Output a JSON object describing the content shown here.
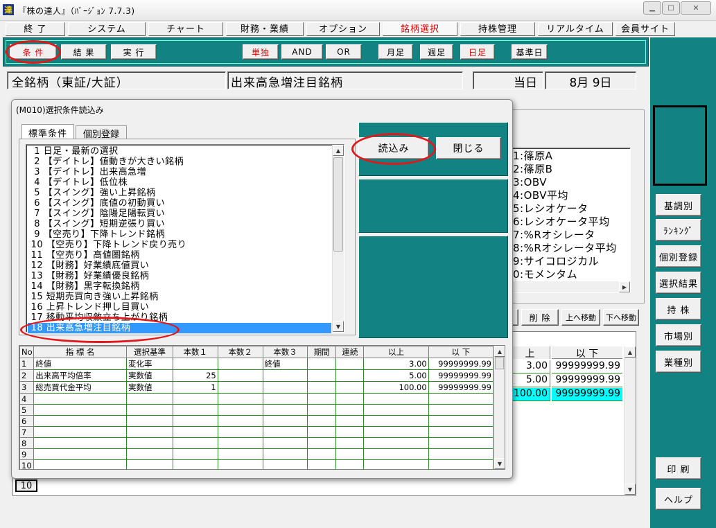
{
  "window": {
    "title": "『株の達人』（ﾊﾞｰｼﾞｮﾝ 7.7.3)",
    "logo": "達"
  },
  "menu": [
    "終 了",
    "システム",
    "チャート",
    "財務・業績",
    "オプション",
    "銘柄選択",
    "持株管理",
    "リアルタイム",
    "会員サイト"
  ],
  "toolbar": {
    "jouken": "条 件",
    "kekka": "結 果",
    "jikkou": "実 行",
    "tandoku": "単独",
    "and": "AND",
    "or": "OR",
    "getsu": "月足",
    "shuu": "週足",
    "hi": "日足",
    "kijunbi": "基準日"
  },
  "header": {
    "market": "全銘柄（東証/大証）",
    "screen": "出来高急増注目銘柄",
    "touka_label": "当日",
    "date": "8月 9日"
  },
  "right_buttons": [
    "基調別",
    "ﾗﾝｷﾝｸﾞ",
    "個別登録",
    "選択結果",
    "持 株",
    "市場別",
    "業種別"
  ],
  "bottom_buttons": [
    "印 刷",
    "ヘルプ"
  ],
  "bg_indicator_list": [
    "1:篠原A",
    "2:篠原B",
    "3:OBV",
    "4:OBV平均",
    "5:レシオケータ",
    "6:レシオケータ平均",
    "7:%Rオシレータ",
    "8:%Rオシレータ平均",
    "9:サイコロジカル",
    "0:モメンタム"
  ],
  "bg_actions": [
    "削 除",
    "上へ移動",
    "下へ移動"
  ],
  "bg_table": {
    "headers": [
      "上",
      "以 下"
    ],
    "rows": [
      [
        "3.00",
        "99999999.99"
      ],
      [
        "5.00",
        "99999999.99"
      ],
      [
        "100.00",
        "99999999.99"
      ]
    ],
    "row_label_10": "10"
  },
  "dialog": {
    "title": "(M010)選択条件読込み",
    "tabs": [
      "標準条件",
      "個別登録"
    ],
    "load_button": "読込み",
    "close_button": "閉じる",
    "conditions": [
      "  1 日足・最新の選択",
      "  2 【デイトレ】値動きが大きい銘柄",
      "  3 【デイトレ】出来高急増",
      "  4 【デイトレ】低位株",
      "  5 【スイング】強い上昇銘柄",
      "  6 【スイング】底値の初動買い",
      "  7 【スイング】陰陽足陽転買い",
      "  8 【スイング】短期逆張り買い",
      "  9 【空売り】下降トレンド銘柄",
      " 10 【空売り】下降トレンド戻り売り",
      " 11 【空売り】高値圏銘柄",
      " 12 【財務】好業績底値買い",
      " 13 【財務】好業績優良銘柄",
      " 14 【財務】黒字転換銘柄",
      " 15 短期売買向き強い上昇銘柄",
      " 16 上昇トレンド押し目買い",
      " 17 移動平均収斂立ち上がり銘柄",
      " 18 出来高急増注目銘柄"
    ],
    "selected_index": 17,
    "table": {
      "headers": [
        "No",
        "指 標 名",
        "選択基準",
        "本数１",
        "本数２",
        "本数３",
        "期間",
        "連続",
        "以上",
        "以 下"
      ],
      "rows": [
        [
          "1",
          "終値",
          "変化率",
          "",
          "",
          "終値",
          "",
          "",
          "3.00",
          "99999999.99"
        ],
        [
          "2",
          "出来高平均倍率",
          "実数値",
          "25",
          "",
          "",
          "",
          "",
          "5.00",
          "99999999.99"
        ],
        [
          "3",
          "総売買代金平均",
          "実数値",
          "1",
          "",
          "",
          "",
          "",
          "100.00",
          "99999999.99"
        ],
        [
          "4",
          "",
          "",
          "",
          "",
          "",
          "",
          "",
          "",
          ""
        ],
        [
          "5",
          "",
          "",
          "",
          "",
          "",
          "",
          "",
          "",
          ""
        ],
        [
          "6",
          "",
          "",
          "",
          "",
          "",
          "",
          "",
          "",
          ""
        ],
        [
          "7",
          "",
          "",
          "",
          "",
          "",
          "",
          "",
          "",
          ""
        ],
        [
          "8",
          "",
          "",
          "",
          "",
          "",
          "",
          "",
          "",
          ""
        ],
        [
          "9",
          "",
          "",
          "",
          "",
          "",
          "",
          "",
          "",
          ""
        ],
        [
          "10",
          "",
          "",
          "",
          "",
          "",
          "",
          "",
          "",
          ""
        ]
      ]
    }
  },
  "colors": {
    "teal": "#128282",
    "highlight_red": "#e0191d",
    "selection_blue": "#3399ff",
    "cyan_row": "#00ffff"
  }
}
